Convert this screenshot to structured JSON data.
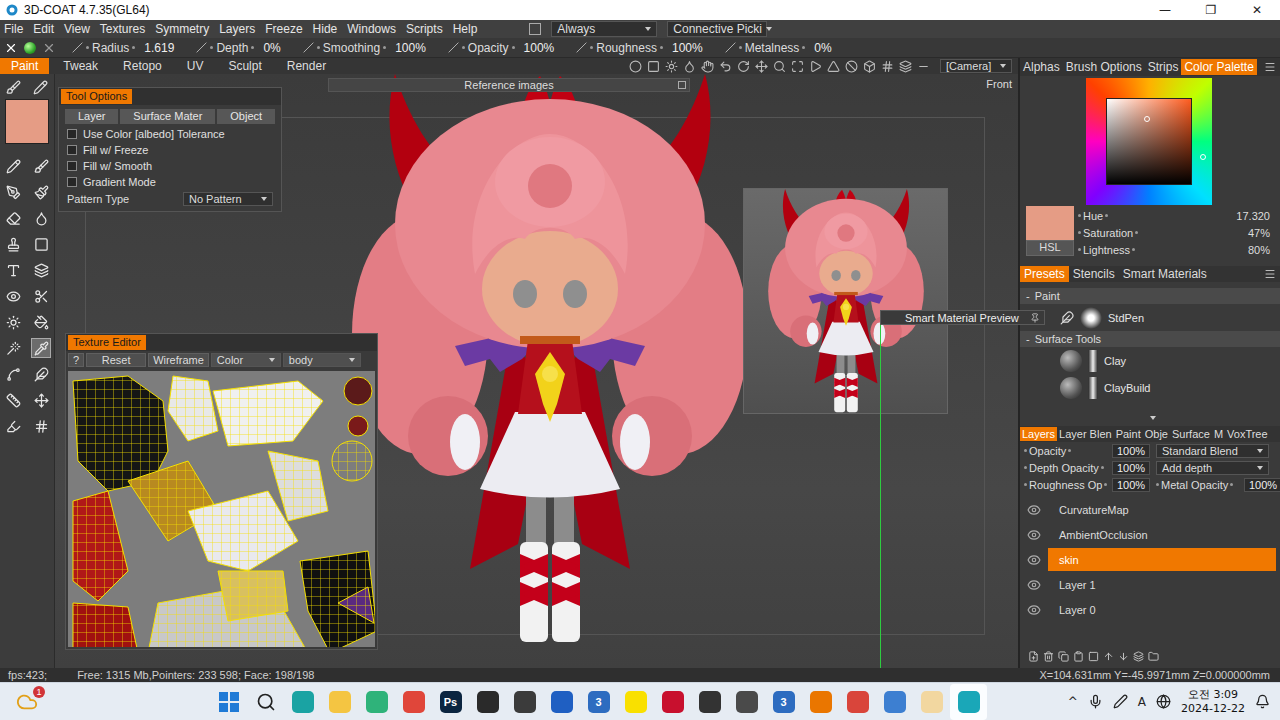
{
  "window": {
    "title": "3D-COAT 4.7.35(GL64)",
    "controls": [
      "—",
      "❐",
      "✕"
    ]
  },
  "menu": {
    "items": [
      "File",
      "Edit",
      "View",
      "Textures",
      "Symmetry",
      "Layers",
      "Freeze",
      "Hide",
      "Windows",
      "Scripts",
      "Help"
    ],
    "toggle_checked": false,
    "dropdowns": [
      "Always",
      "Connective Picki"
    ]
  },
  "brush_bar": {
    "params": [
      {
        "label": "Radius",
        "value": "1.619"
      },
      {
        "label": "Depth",
        "value": "0%"
      },
      {
        "label": "Smoothing",
        "value": "100%"
      },
      {
        "label": "Opacity",
        "value": "100%"
      },
      {
        "label": "Roughness",
        "value": "100%"
      },
      {
        "label": "Metalness",
        "value": "0%"
      }
    ]
  },
  "rooms": [
    {
      "label": "Paint",
      "selected": true
    },
    {
      "label": "Tweak",
      "selected": false
    },
    {
      "label": "Retopo",
      "selected": false
    },
    {
      "label": "UV",
      "selected": false
    },
    {
      "label": "Sculpt",
      "selected": false
    },
    {
      "label": "Render",
      "selected": false
    }
  ],
  "camera": "[Camera]",
  "tools": {
    "primary_color": "#e59c85",
    "items": [
      {
        "selected": false
      },
      {
        "selected": false
      },
      {
        "selected": false
      },
      {
        "selected": false
      },
      {
        "selected": false
      },
      {
        "selected": false
      },
      {
        "selected": false
      },
      {
        "selected": false
      },
      {
        "selected": false
      },
      {
        "selected": false
      },
      {
        "selected": false
      },
      {
        "selected": false
      },
      {
        "selected": false
      },
      {
        "selected": false
      },
      {
        "selected": false
      },
      {
        "selected": true
      },
      {
        "selected": false
      },
      {
        "selected": false
      },
      {
        "selected": false
      },
      {
        "selected": false
      },
      {
        "selected": false
      },
      {
        "selected": false
      }
    ]
  },
  "viewport": {
    "view_label": "Front",
    "reference_bar": "Reference images",
    "tooltip": "Smart Material Preview"
  },
  "tool_options": {
    "title": "Tool Options",
    "tabs": [
      {
        "label": "Layer",
        "selected": false
      },
      {
        "label": "Surface Mater",
        "selected": false
      },
      {
        "label": "Object",
        "selected": false
      }
    ],
    "options": [
      {
        "label": "Use Color [albedo] Tolerance",
        "checked": false
      },
      {
        "label": "Fill w/ Freeze",
        "checked": false
      },
      {
        "label": "Fill w/ Smooth",
        "checked": false
      },
      {
        "label": "Gradient Mode",
        "checked": false
      }
    ],
    "pattern": {
      "label": "Pattern Type",
      "value": "No Pattern"
    }
  },
  "texture_editor": {
    "title": "Texture Editor",
    "help": "?",
    "buttons": [
      "Reset",
      "Wireframe"
    ],
    "dropdowns": [
      "Color",
      "body"
    ]
  },
  "right_tabs": [
    {
      "label": "Alphas",
      "selected": false
    },
    {
      "label": "Brush Options",
      "selected": false
    },
    {
      "label": "Strips",
      "selected": false
    },
    {
      "label": "Color Palette",
      "selected": true
    }
  ],
  "color_palette": {
    "swatch": "#e59c85",
    "pure_hue": "#ff5c1f",
    "mode_button": "HSL",
    "sv_x": 0.48,
    "sv_y": 0.23,
    "hue_marker": 0.62,
    "sliders": [
      {
        "label": "Hue",
        "value": "17.320"
      },
      {
        "label": "Saturation",
        "value": "47%"
      },
      {
        "label": "Lightness",
        "value": "80%"
      }
    ]
  },
  "preset_tabs": [
    {
      "label": "Presets",
      "selected": true
    },
    {
      "label": "Stencils",
      "selected": false
    },
    {
      "label": "Smart Materials",
      "selected": false
    }
  ],
  "presets": {
    "groups": [
      {
        "marker": "-",
        "title": "Paint",
        "kind": "paint",
        "expanded": true,
        "items": [
          "StdPen"
        ]
      },
      {
        "marker": "-",
        "title": "Surface Tools",
        "kind": "surface",
        "expanded": true,
        "items": [
          "Clay",
          "ClayBuild"
        ]
      }
    ]
  },
  "layer_tabs": [
    {
      "label": "Layers",
      "selected": true
    },
    {
      "label": "Layer Blen",
      "selected": false
    },
    {
      "label": "Paint",
      "selected": false
    },
    {
      "label": "Obje",
      "selected": false
    },
    {
      "label": "Surface",
      "selected": false
    },
    {
      "label": "M",
      "selected": false
    },
    {
      "label": "VoxTree",
      "selected": false
    }
  ],
  "layer_props": [
    {
      "kind": "dropdown",
      "label": "Opacity",
      "value": "100%",
      "dropdown": "Standard Blend"
    },
    {
      "kind": "dropdown",
      "label": "Depth Opacity",
      "value": "100%",
      "dropdown": "Add depth"
    },
    {
      "kind": "pair",
      "label": "Roughness Op",
      "value": "100%",
      "second_label": "Metal Opacity",
      "second_value": "100%"
    }
  ],
  "layers": [
    {
      "name": "CurvatureMap",
      "visible": true,
      "selected": false
    },
    {
      "name": "AmbientOcclusion",
      "visible": true,
      "selected": false
    },
    {
      "name": "skin",
      "visible": true,
      "selected": true
    },
    {
      "name": "Layer 1",
      "visible": true,
      "selected": false
    },
    {
      "name": "Layer 0",
      "visible": true,
      "selected": false
    }
  ],
  "status_bar": {
    "fps": "fps:423;",
    "memory": "Free: 1315 Mb,Pointers: 233 598; Face: 198/198",
    "coords": "X=104.631mm Y=-45.9971mm Z=0.000000mm"
  },
  "taskbar": {
    "weather_badge": "1",
    "apps": [
      {
        "kind": "start",
        "selected": false
      },
      {
        "kind": "search",
        "selected": false
      },
      {
        "kind": "app",
        "color": "#1aa3a3",
        "selected": false
      },
      {
        "kind": "app",
        "color": "#f4c542",
        "selected": false
      },
      {
        "kind": "app",
        "color": "#2fb37a",
        "selected": false
      },
      {
        "kind": "app",
        "color": "#e0463a",
        "selected": false
      },
      {
        "kind": "app",
        "color": "#0b2540",
        "label": "Ps",
        "selected": false
      },
      {
        "kind": "app",
        "color": "#2a2a2a",
        "selected": false
      },
      {
        "kind": "app",
        "color": "#3b3b3b",
        "selected": false
      },
      {
        "kind": "app",
        "color": "#1f5fc2",
        "selected": false
      },
      {
        "kind": "app",
        "color": "#2d6cc0",
        "label": "3",
        "selected": false
      },
      {
        "kind": "app",
        "color": "#f9e000",
        "selected": false
      },
      {
        "kind": "app",
        "color": "#c8102e",
        "selected": false
      },
      {
        "kind": "app",
        "color": "#333333",
        "selected": false
      },
      {
        "kind": "app",
        "color": "#4a4a4a",
        "selected": false
      },
      {
        "kind": "app",
        "color": "#2d6cc0",
        "label": "3",
        "selected": false
      },
      {
        "kind": "app",
        "color": "#ea7600",
        "selected": false
      },
      {
        "kind": "app",
        "color": "#d9453b",
        "selected": false
      },
      {
        "kind": "app",
        "color": "#3d7fd1",
        "selected": false
      },
      {
        "kind": "app",
        "color": "#f2d7a0",
        "selected": false
      },
      {
        "kind": "app",
        "color": "#1aa7b8",
        "selected": true
      }
    ],
    "tray": {
      "chevron": "^",
      "ime": "A",
      "time": "오전 3:09",
      "date": "2024-12-22"
    }
  }
}
